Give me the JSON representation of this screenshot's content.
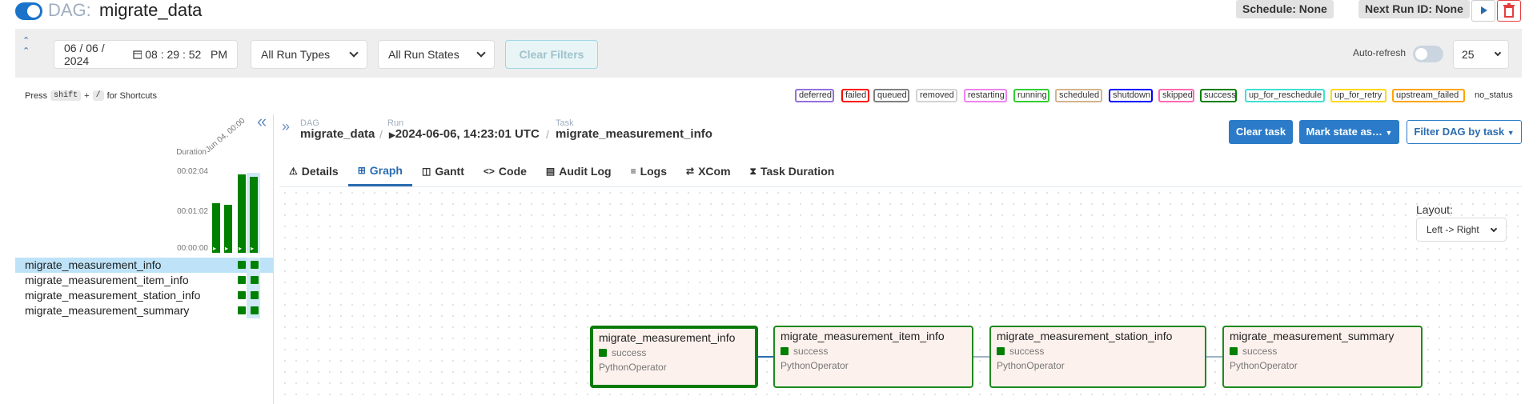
{
  "header": {
    "dag_prefix": "DAG:",
    "dag_name": "migrate_data",
    "schedule": "Schedule: None",
    "next_run": "Next Run ID: None",
    "info_icon": "i"
  },
  "filters": {
    "date": "06 / 06 / 2024",
    "time": "08 : 29 : 52   PM",
    "run_types": "All Run Types",
    "run_states": "All Run States",
    "clear_filters": "Clear Filters",
    "auto_refresh": "Auto-refresh",
    "num_runs": "25"
  },
  "shortcuts": {
    "press": "Press",
    "key1": "shift",
    "plus": "+",
    "key2": "/",
    "suffix": "for Shortcuts"
  },
  "legend": [
    {
      "label": "deferred",
      "color": "#9370db"
    },
    {
      "label": "failed",
      "color": "#ff0000"
    },
    {
      "label": "queued",
      "color": "#808080"
    },
    {
      "label": "removed",
      "color": "#d3d3d3"
    },
    {
      "label": "restarting",
      "color": "#ee82ee"
    },
    {
      "label": "running",
      "color": "#32cd32"
    },
    {
      "label": "scheduled",
      "color": "#d2b48c"
    },
    {
      "label": "shutdown",
      "color": "#0000ff"
    },
    {
      "label": "skipped",
      "color": "#ff69b4"
    },
    {
      "label": "success",
      "color": "#008000"
    },
    {
      "label": "up_for_reschedule",
      "color": "#40e0d0"
    },
    {
      "label": "up_for_retry",
      "color": "#ffd700"
    },
    {
      "label": "upstream_failed",
      "color": "#ffa500"
    },
    {
      "label": "no_status",
      "color": "transparent"
    }
  ],
  "grid": {
    "duration_label": "Duration",
    "date_label": "Jun 04, 00:00",
    "ticks": [
      "00:02:04",
      "00:01:02",
      "00:00:00"
    ],
    "run_durations_fraction": [
      0.62,
      0.6,
      0.98,
      0.95
    ],
    "tasks": [
      "migrate_measurement_info",
      "migrate_measurement_item_info",
      "migrate_measurement_station_info",
      "migrate_measurement_summary"
    ]
  },
  "breadcrumb": {
    "dag_label": "DAG",
    "dag_value": "migrate_data",
    "run_label": "Run",
    "run_value": "2024-06-06, 14:23:01 UTC",
    "task_label": "Task",
    "task_value": "migrate_measurement_info"
  },
  "actions": {
    "clear_task": "Clear task",
    "mark_state": "Mark state as…",
    "filter_dag": "Filter DAG by task"
  },
  "tabs": [
    {
      "label": "Details",
      "icon": "⚠"
    },
    {
      "label": "Graph",
      "icon": "⊞"
    },
    {
      "label": "Gantt",
      "icon": "◫"
    },
    {
      "label": "Code",
      "icon": "<>"
    },
    {
      "label": "Audit Log",
      "icon": "▤"
    },
    {
      "label": "Logs",
      "icon": "≡"
    },
    {
      "label": "XCom",
      "icon": "⇄"
    },
    {
      "label": "Task Duration",
      "icon": "⧗"
    }
  ],
  "graph": {
    "layout_label": "Layout:",
    "layout_value": "Left -> Right",
    "nodes": [
      {
        "title": "migrate_measurement_info",
        "status": "success",
        "operator": "PythonOperator"
      },
      {
        "title": "migrate_measurement_item_info",
        "status": "success",
        "operator": "PythonOperator"
      },
      {
        "title": "migrate_measurement_station_info",
        "status": "success",
        "operator": "PythonOperator"
      },
      {
        "title": "migrate_measurement_summary",
        "status": "success",
        "operator": "PythonOperator"
      }
    ]
  }
}
